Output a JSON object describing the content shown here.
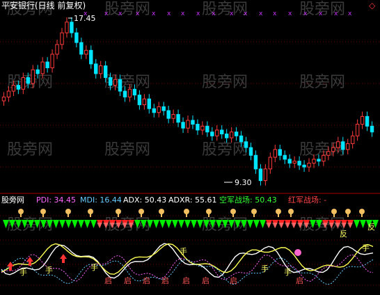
{
  "header": {
    "title": "平安银行(日线 前复权)",
    "diamond_glyph": "◇"
  },
  "watermark": {
    "text": "股旁网"
  },
  "price_panel": {
    "high_label": "17.45",
    "low_label": "9.30",
    "x_marker": "x"
  },
  "indicator_bar": {
    "site": "股旁网",
    "pdi": "PDI: 34.45",
    "mdi": "MDI: 16.44",
    "adx": "ADX: 50.43",
    "adxr": "ADXR: 55.61",
    "kong": "空军战场: 50.43",
    "hong": "红军战场: -"
  },
  "signal_labels": {
    "qi": "启",
    "fan": "反",
    "shou": "手"
  },
  "colors": {
    "up_candle": "#ff3b3b",
    "down_candle": "#00e5ff",
    "pdi": "#ff66ff",
    "mdi": "#66ccff",
    "adx": "#ffffff",
    "adxr": "#ffff55",
    "kong": "#33ff33",
    "hong": "#ff4444",
    "green_band": "#00ee00",
    "red_band": "#ff2020",
    "header_text": "#ffffff",
    "grid": "#7a0000"
  },
  "chart_data": {
    "type": "candlestick",
    "series": [
      {
        "name": "平安银行",
        "values": [
          13.6,
          13.9,
          14.2,
          14.0,
          14.6,
          14.3,
          15.0,
          14.8,
          15.4,
          15.1,
          15.8,
          16.3,
          16.9,
          17.45,
          16.9,
          16.4,
          15.8,
          16.0,
          15.3,
          14.8,
          15.2,
          14.6,
          14.2,
          14.5,
          13.9,
          13.6,
          14.0,
          13.7,
          13.2,
          13.5,
          13.0,
          12.8,
          13.1,
          12.9,
          12.5,
          12.7,
          12.3,
          12.0,
          12.4,
          12.2,
          11.9,
          12.1,
          11.8,
          11.6,
          11.9,
          11.7,
          11.5,
          11.8,
          11.6,
          11.3,
          11.0,
          10.6,
          9.9,
          9.3,
          9.9,
          10.5,
          10.9,
          10.6,
          10.4,
          10.2,
          10.3,
          10.1,
          10.0,
          10.2,
          10.4,
          10.3,
          10.6,
          10.8,
          11.0,
          11.3,
          10.9,
          11.2,
          11.6,
          12.2,
          12.6,
          12.1,
          11.8
        ]
      }
    ],
    "annotations": [
      "17.45",
      "9.30"
    ],
    "indicators": {
      "PDI": 34.45,
      "MDI": 16.44,
      "ADX": 50.43,
      "ADXR": 55.61,
      "空军战场": 50.43,
      "红军战场": "-"
    },
    "ylim": [
      9.0,
      17.8
    ]
  }
}
